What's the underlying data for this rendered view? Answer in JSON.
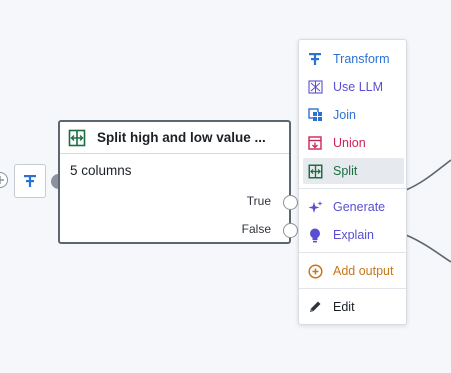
{
  "node": {
    "title": "Split high and low value ...",
    "subtitle": "5 columns",
    "outputs": [
      "True",
      "False"
    ]
  },
  "menu": {
    "items": [
      {
        "label": "Transform",
        "icon": "transform-icon",
        "color": "#2d72d2"
      },
      {
        "label": "Use LLM",
        "icon": "llm-icon",
        "color": "#5a4fcf"
      },
      {
        "label": "Join",
        "icon": "join-icon",
        "color": "#2d72d2"
      },
      {
        "label": "Union",
        "icon": "union-icon",
        "color": "#cd2457"
      },
      {
        "label": "Split",
        "icon": "split-icon",
        "color": "#1c6e42",
        "active": true
      },
      {
        "label": "Generate",
        "icon": "sparkle-icon",
        "color": "#5a4fcf"
      },
      {
        "label": "Explain",
        "icon": "lightbulb-icon",
        "color": "#5a4fcf"
      },
      {
        "label": "Add output",
        "icon": "add-circle-icon",
        "color": "#c87619"
      },
      {
        "label": "Edit",
        "icon": "pencil-icon",
        "color": "#1c2127"
      }
    ]
  },
  "colors": {
    "split_green": "#1c6e42",
    "transform_blue": "#2d72d2",
    "port_gray": "#8a939d",
    "node_border": "#5c6670"
  }
}
